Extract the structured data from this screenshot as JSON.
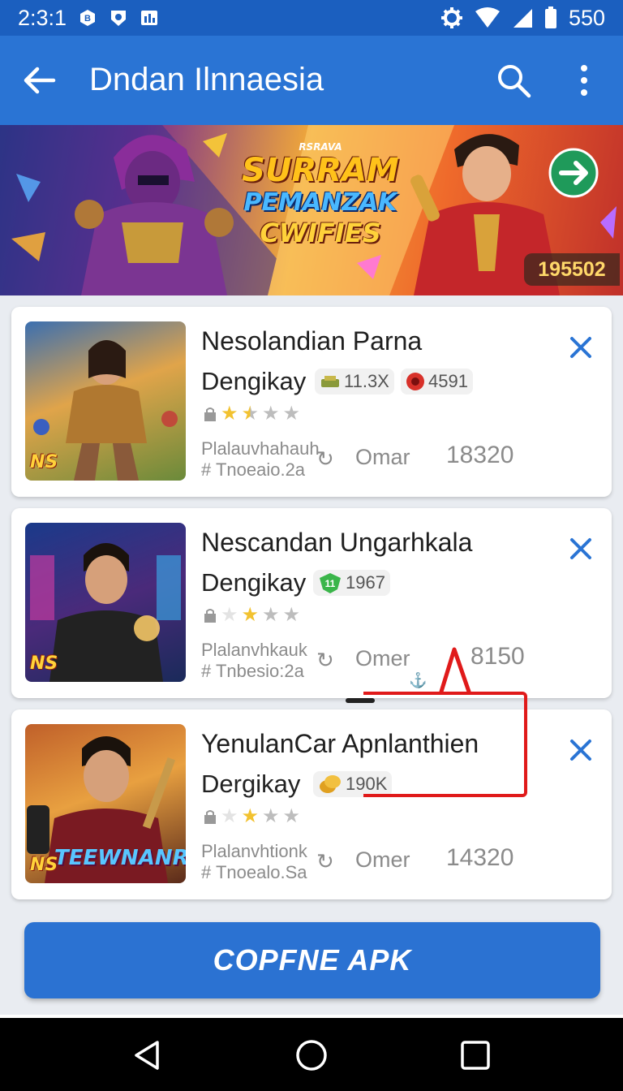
{
  "status_bar": {
    "time": "2:3:1",
    "level": "550",
    "icons": [
      "app-notification-icon",
      "shield-notification-icon",
      "chart-notification-icon",
      "settings-gear-icon",
      "wifi-icon",
      "signal-icon",
      "battery-icon"
    ]
  },
  "app_bar": {
    "title": "Dndan Ilnnaesia",
    "icons": [
      "back-arrow-icon",
      "search-icon",
      "more-vert-icon"
    ]
  },
  "banner": {
    "kicker": "RSRAVA",
    "line1": "SURRAM",
    "line2": "PEMANZAK",
    "line3": "CWIFIES",
    "count": "195502"
  },
  "items": [
    {
      "title": "Nesolandian Parna",
      "subtitle": "Dengikay",
      "tags": [
        {
          "icon": "money-icon",
          "text": "11.3X"
        },
        {
          "icon": "red-coin-icon",
          "text": "4591"
        }
      ],
      "rating": 1.5,
      "meta_line1": "Plalauvhahauh",
      "meta_line2": "# Tnoeaio.2a",
      "owner": "Omar",
      "number": "18320",
      "thumb_badge": "NS"
    },
    {
      "title": "Nescandan Ungarhkala",
      "subtitle": "Dengikay",
      "tags": [
        {
          "icon": "green-shield-icon",
          "text": "1967"
        }
      ],
      "rating": 1,
      "meta_line1": "Plalanvhkauk",
      "meta_line2": "# Tnbesio:2a",
      "owner": "Omer",
      "number": "8150",
      "thumb_badge": "NS"
    },
    {
      "title": "YenulanCar Apnlanthien",
      "subtitle": "Dergikay",
      "tags": [
        {
          "icon": "coins-icon",
          "text": "190K"
        }
      ],
      "rating": 1,
      "meta_line1": "Plalanvhtionk",
      "meta_line2": "# Tnoealo.Sa",
      "owner": "Omer",
      "number": "14320",
      "thumb_badge": "NS",
      "thumb_title": "TEEWNANR"
    }
  ],
  "cta": {
    "label": "COPFNE APK"
  },
  "nav": {
    "icons": [
      "nav-back-icon",
      "nav-home-icon",
      "nav-recents-icon"
    ]
  },
  "colors": {
    "status_bar": "#1b5fbf",
    "app_bar": "#2a74d4",
    "accent_x": "#2a74d4",
    "annotation": "#e01a1a"
  }
}
